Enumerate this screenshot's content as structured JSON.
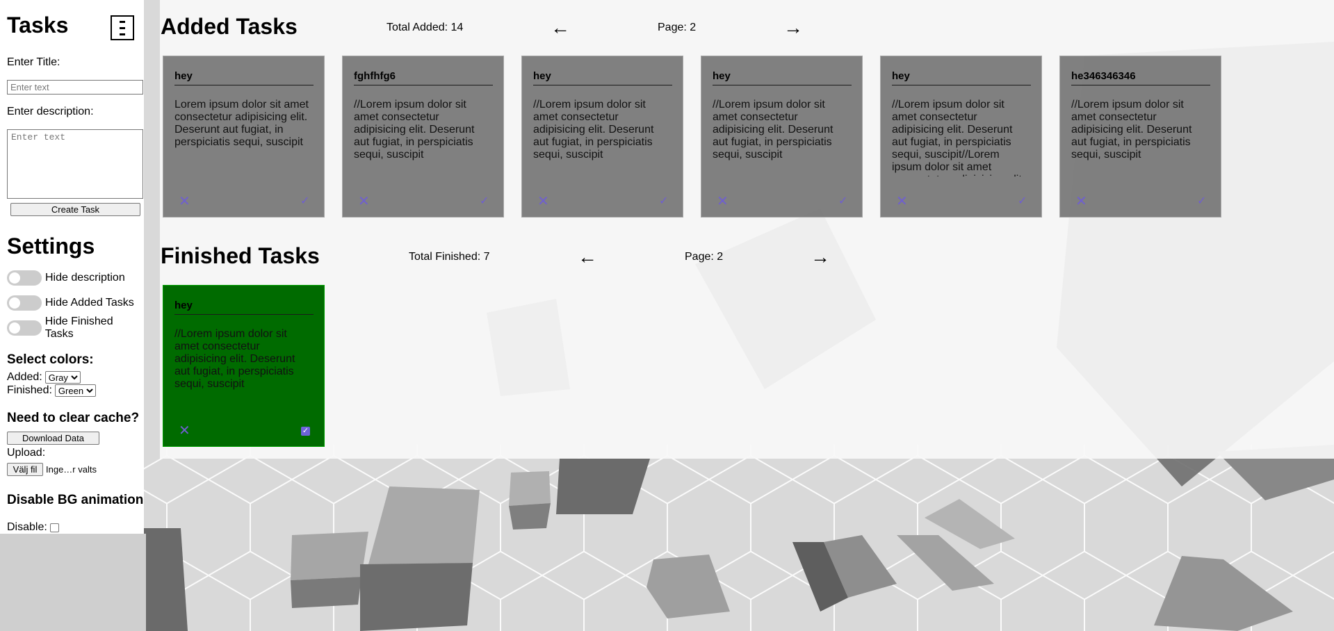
{
  "sidebar": {
    "title": "Tasks",
    "title_label": "Enter Title:",
    "title_placeholder": "Enter text",
    "desc_label": "Enter description:",
    "desc_placeholder": "Enter text",
    "create_button": "Create Task",
    "settings_title": "Settings",
    "toggles": [
      {
        "label": "Hide description",
        "on": false
      },
      {
        "label": "Hide Added Tasks",
        "on": false
      },
      {
        "label": "Hide Finished Tasks",
        "on": false
      }
    ],
    "colors_title": "Select colors:",
    "added_label": "Added:",
    "added_value": "Gray",
    "finished_label": "Finished:",
    "finished_value": "Green",
    "cache_title": "Need to clear cache?",
    "download_button": "Download Data",
    "upload_label": "Upload:",
    "file_button": "Välj fil",
    "file_status": "Inge…r valts",
    "bg_title": "Disable BG animation",
    "disable_label": "Disable:"
  },
  "added": {
    "title": "Added Tasks",
    "total": "Total Added: 14",
    "prev": "←",
    "page": "Page: 2",
    "next": "→",
    "tasks": [
      {
        "title": "hey",
        "desc": "Lorem ipsum dolor sit amet consectetur adipisicing elit. Deserunt aut fugiat, in perspiciatis sequi, suscipit"
      },
      {
        "title": "fghfhfg6",
        "desc": "//Lorem ipsum dolor sit amet consectetur adipisicing elit. Deserunt aut fugiat, in perspiciatis sequi, suscipit"
      },
      {
        "title": "hey",
        "desc": "//Lorem ipsum dolor sit amet consectetur adipisicing elit. Deserunt aut fugiat, in perspiciatis sequi, suscipit"
      },
      {
        "title": "hey",
        "desc": "//Lorem ipsum dolor sit amet consectetur adipisicing elit. Deserunt aut fugiat, in perspiciatis sequi, suscipit"
      },
      {
        "title": "hey",
        "desc": "//Lorem ipsum dolor sit amet consectetur adipisicing elit. Deserunt aut fugiat, in perspiciatis sequi, suscipit//Lorem ipsum dolor sit amet consectetur adipisicing elit"
      },
      {
        "title": "he346346346",
        "desc": "//Lorem ipsum dolor sit amet consectetur adipisicing elit. Deserunt aut fugiat, in perspiciatis sequi, suscipit"
      }
    ]
  },
  "finished": {
    "title": "Finished Tasks",
    "total": "Total Finished: 7",
    "prev": "←",
    "page": "Page: 2",
    "next": "→",
    "tasks": [
      {
        "title": "hey",
        "desc": "//Lorem ipsum dolor sit amet consectetur adipisicing elit. Deserunt aut fugiat, in perspiciatis sequi, suscipit"
      }
    ]
  },
  "icons": {
    "menu": "menu-icon",
    "delete": "close-icon",
    "done": "check-icon"
  },
  "colors": {
    "added_card": "#767676",
    "finished_card": "#006b00",
    "icon_accent": "#6f5fcf"
  }
}
